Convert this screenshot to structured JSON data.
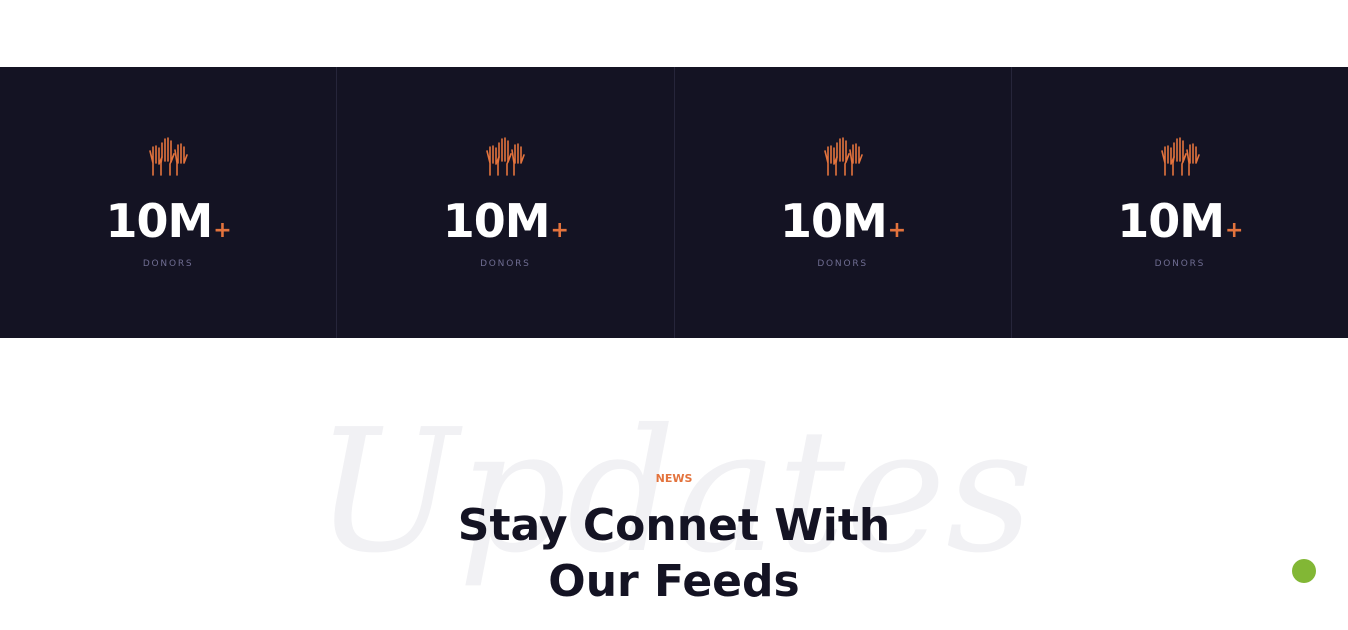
{
  "stats": [
    {
      "icon": "raised-hands-icon",
      "number": "10M",
      "suffix": "+",
      "label": "DONORS"
    },
    {
      "icon": "raised-hands-icon",
      "number": "10M",
      "suffix": "+",
      "label": "DONORS"
    },
    {
      "icon": "raised-hands-icon",
      "number": "10M",
      "suffix": "+",
      "label": "DONORS"
    },
    {
      "icon": "raised-hands-icon",
      "number": "10M",
      "suffix": "+",
      "label": "DONORS"
    }
  ],
  "news": {
    "watermark": "Updates",
    "eyebrow": "NEWS",
    "heading_line1": "Stay Connet With",
    "heading_line2": "Our Feeds"
  },
  "colors": {
    "band_background": "#141323",
    "accent": "#e3733d",
    "fab": "#82b735"
  }
}
